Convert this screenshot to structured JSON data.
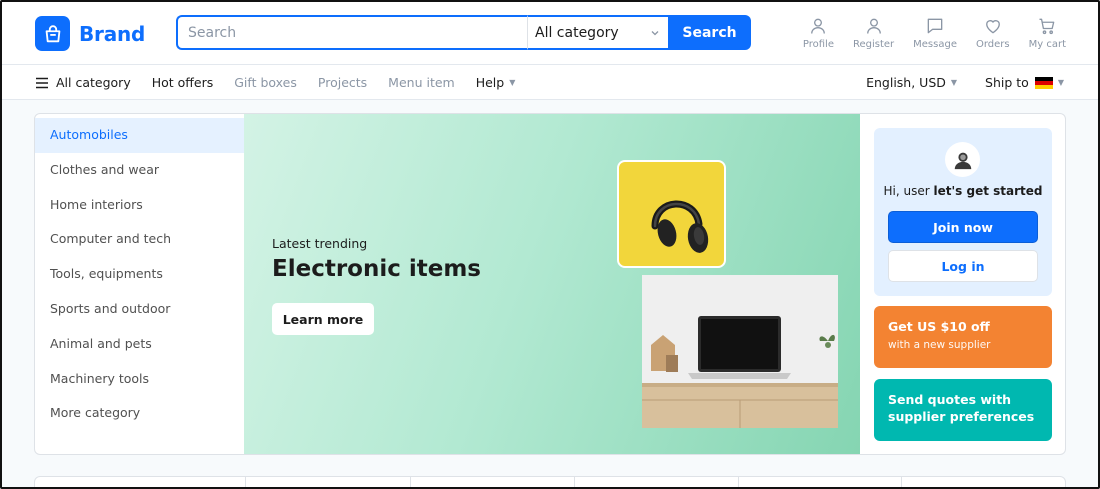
{
  "brand": {
    "name": "Brand"
  },
  "search": {
    "placeholder": "Search",
    "value": "",
    "category": "All category",
    "button": "Search"
  },
  "header_actions": [
    {
      "label": "Profile",
      "icon": "user-icon"
    },
    {
      "label": "Register",
      "icon": "user-icon"
    },
    {
      "label": "Message",
      "icon": "message-icon"
    },
    {
      "label": "Orders",
      "icon": "heart-icon"
    },
    {
      "label": "My cart",
      "icon": "cart-icon"
    }
  ],
  "nav": {
    "all_category": "All category",
    "items": [
      "Hot offers",
      "Gift boxes",
      "Projects",
      "Menu item",
      "Help"
    ],
    "language": "English, USD",
    "ship_to": "Ship to"
  },
  "categories": [
    "Automobiles",
    "Clothes and wear",
    "Home interiors",
    "Computer and tech",
    "Tools, equipments",
    "Sports and outdoor",
    "Animal and pets",
    "Machinery tools",
    "More category"
  ],
  "banner": {
    "subtitle": "Latest trending",
    "title": "Electronic items",
    "button": "Learn more"
  },
  "user_card": {
    "greeting_prefix": "Hi, user",
    "greeting_bold": "let's get started",
    "join": "Join now",
    "login": "Log in"
  },
  "promos": {
    "orange_title": "Get US $10 off",
    "orange_sub": "with a new supplier",
    "teal_title": "Send quotes with supplier preferences"
  },
  "colors": {
    "primary": "#0d6efd",
    "orange": "#f38332",
    "teal": "#00b8b0"
  }
}
